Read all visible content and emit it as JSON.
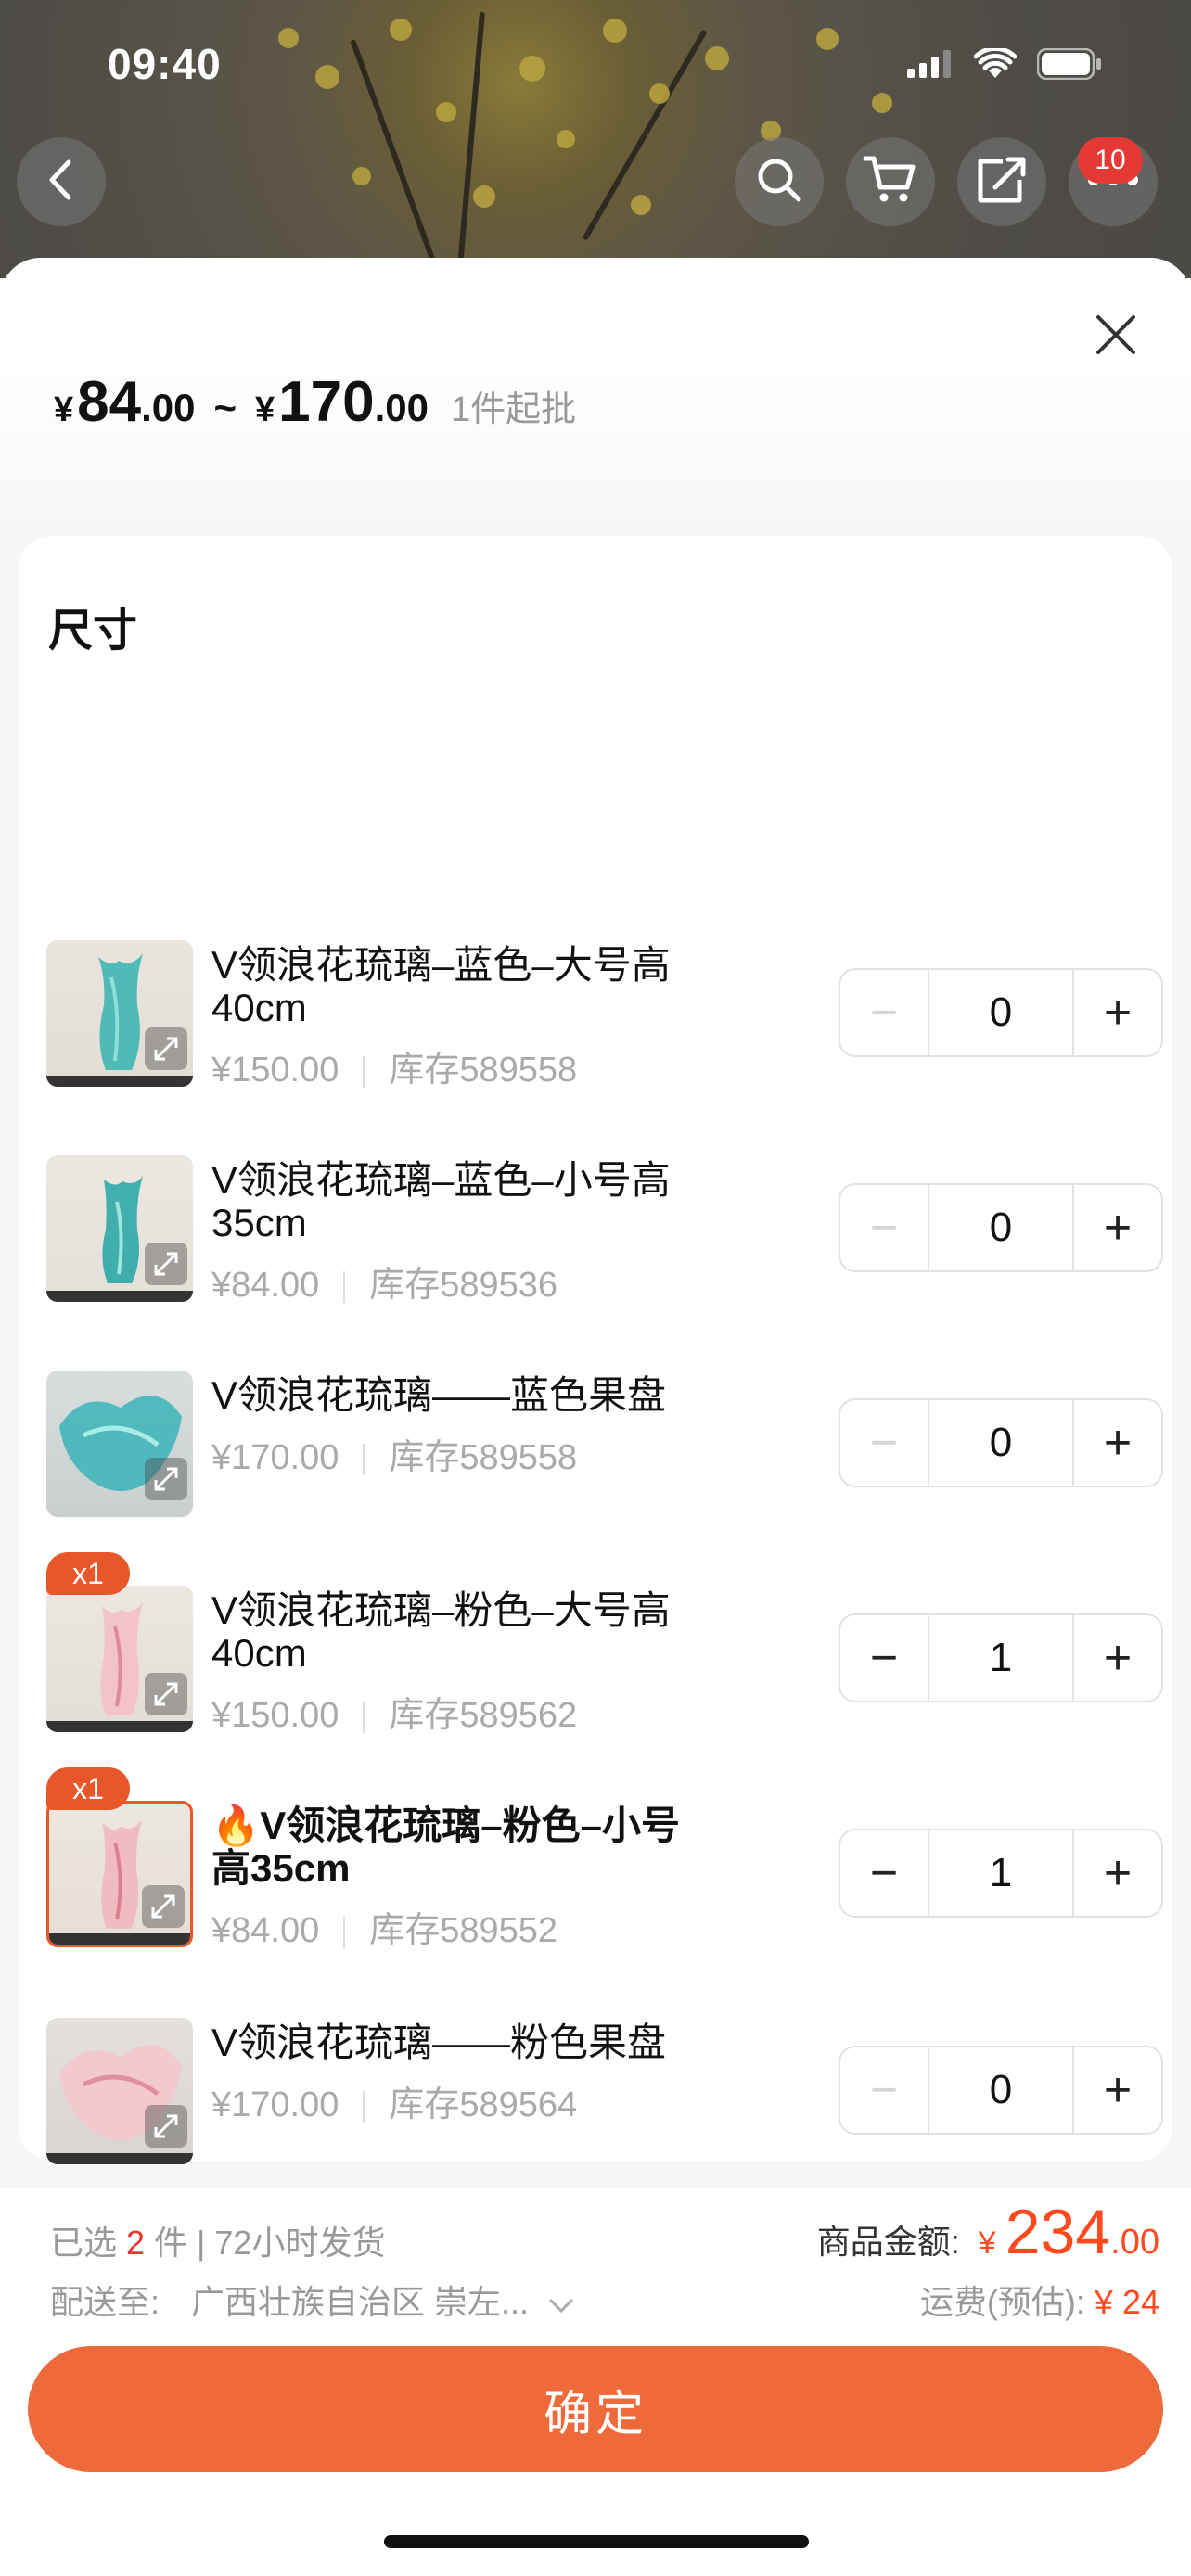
{
  "status_bar": {
    "time": "09:40"
  },
  "nav": {
    "cart_badge": "10"
  },
  "sheet": {
    "price_low_currency": "¥",
    "price_low_int": "84",
    "price_low_dec": ".00",
    "tilde": "~",
    "price_high_currency": "¥",
    "price_high_int": "170",
    "price_high_dec": ".00",
    "min_order": "1件起批",
    "section_title": "尺寸"
  },
  "items": [
    {
      "name": "V领浪花琉璃–蓝色–大号高40cm",
      "price": "¥150.00",
      "stock": "库存589558",
      "qty": "0",
      "badge": "",
      "prefix": ""
    },
    {
      "name": "V领浪花琉璃–蓝色–小号高35cm",
      "price": "¥84.00",
      "stock": "库存589536",
      "qty": "0",
      "badge": "",
      "prefix": ""
    },
    {
      "name": "V领浪花琉璃——蓝色果盘",
      "price": "¥170.00",
      "stock": "库存589558",
      "qty": "0",
      "badge": "",
      "prefix": ""
    },
    {
      "name": "V领浪花琉璃–粉色–大号高40cm",
      "price": "¥150.00",
      "stock": "库存589562",
      "qty": "1",
      "badge": "x1",
      "prefix": ""
    },
    {
      "name": "V领浪花琉璃–粉色–小号高35cm",
      "price": "¥84.00",
      "stock": "库存589552",
      "qty": "1",
      "badge": "x1",
      "prefix": "🔥"
    },
    {
      "name": "V领浪花琉璃——粉色果盘",
      "price": "¥170.00",
      "stock": "库存589564",
      "qty": "0",
      "badge": "",
      "prefix": ""
    }
  ],
  "stepper": {
    "minus": "−",
    "plus": "+"
  },
  "footer": {
    "selected_prefix": "已选",
    "selected_count": "2",
    "selected_suffix": "件 | 72小时发货",
    "ship_to_label": "配送至:",
    "ship_to_value": "广西壮族自治区 崇左...",
    "amount_label": "商品金额:",
    "amount_currency": "¥",
    "amount_int": "234",
    "amount_dec": ".00",
    "freight_label": "运费(预估):",
    "freight_value": "¥ 24",
    "confirm_label": "确定"
  },
  "colors": {
    "accent": "#ef6a3a",
    "price_red": "#ff4a1f",
    "badge_red": "#e53935"
  },
  "icons": [
    "back-icon",
    "search-icon",
    "cart-icon",
    "share-icon",
    "more-icon",
    "close-icon",
    "expand-icon",
    "chevron-down-icon",
    "signal-icon",
    "wifi-icon",
    "battery-icon"
  ]
}
